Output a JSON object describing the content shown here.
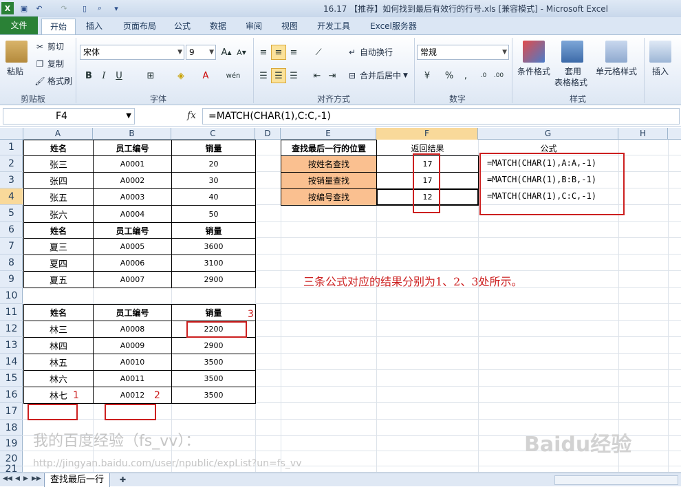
{
  "titlebar": {
    "title": "16.17 【推荐】如何找到最后有效行的行号.xls  [兼容模式] - Microsoft Excel"
  },
  "tabs": [
    "文件",
    "开始",
    "插入",
    "页面布局",
    "公式",
    "数据",
    "审阅",
    "视图",
    "开发工具",
    "Excel服务器"
  ],
  "ribbon": {
    "paste": "粘贴",
    "cut": "剪切",
    "copy": "复制",
    "format_painter": "格式刷",
    "clipboard_label": "剪贴板",
    "font_name": "宋体",
    "font_size": "9",
    "font_label": "字体",
    "wrap_text": "自动换行",
    "merge_center": "合并后居中",
    "alignment_label": "对齐方式",
    "number_format": "常规",
    "number_label": "数字",
    "conditional_format": "条件格式",
    "table_format_1": "套用",
    "table_format_2": "表格格式",
    "cell_styles": "单元格样式",
    "styles_label": "样式",
    "insert": "插入"
  },
  "formula_bar": {
    "name_box": "F4",
    "fx": "fx",
    "formula": "=MATCH(CHAR(1),C:C,-1)"
  },
  "columns": [
    "A",
    "B",
    "C",
    "D",
    "E",
    "F",
    "G",
    "H"
  ],
  "selected_column": "F",
  "rows": [
    "1",
    "2",
    "3",
    "4",
    "5",
    "6",
    "7",
    "8",
    "9",
    "10",
    "11",
    "12",
    "13",
    "14",
    "15",
    "16",
    "17",
    "18",
    "19",
    "20",
    "21"
  ],
  "selected_row": "4",
  "table1": {
    "headers": [
      "姓名",
      "员工编号",
      "销量"
    ],
    "rows": [
      [
        "张三",
        "A0001",
        "20"
      ],
      [
        "张四",
        "A0002",
        "30"
      ],
      [
        "张五",
        "A0003",
        "40"
      ],
      [
        "张六",
        "A0004",
        "50"
      ]
    ]
  },
  "table2": {
    "headers": [
      "姓名",
      "员工编号",
      "销量"
    ],
    "rows": [
      [
        "夏三",
        "A0005",
        "3600"
      ],
      [
        "夏四",
        "A0006",
        "3100"
      ],
      [
        "夏五",
        "A0007",
        "2900"
      ]
    ]
  },
  "table3": {
    "headers": [
      "姓名",
      "员工编号",
      "销量"
    ],
    "rows": [
      [
        "林三",
        "A0008",
        "2200"
      ],
      [
        "林四",
        "A0009",
        "2900"
      ],
      [
        "林五",
        "A0010",
        "3500"
      ],
      [
        "林六",
        "A0011",
        "3500"
      ],
      [
        "林七",
        "A0012",
        "3500"
      ]
    ]
  },
  "lookup": {
    "header_label": "查找最后一行的位置",
    "header_result": "返回结果",
    "header_formula": "公式",
    "rows": [
      {
        "label": "按姓名查找",
        "result": "17",
        "formula": "=MATCH(CHAR(1),A:A,-1)"
      },
      {
        "label": "按销量查找",
        "result": "17",
        "formula": "=MATCH(CHAR(1),B:B,-1)"
      },
      {
        "label": "按编号查找",
        "result": "12",
        "formula": "=MATCH(CHAR(1),C:C,-1)"
      }
    ]
  },
  "annotations": {
    "note": "三条公式对应的结果分别为1、2、3处所示。",
    "mark1": "1",
    "mark2": "2",
    "mark3": "3"
  },
  "watermark": {
    "line1": "我的百度经验（fs_vv）：",
    "line2": "http://jingyan.baidu.com/user/npublic/expList?un=fs_vv",
    "logo": "Baidu经验"
  },
  "sheet": {
    "tab": "查找最后一行"
  },
  "colors": {
    "excel_green": "#2a8136",
    "orange_fill": "#fac090",
    "annotation_red": "#cc1f1f",
    "selection": "#f9d99a"
  }
}
